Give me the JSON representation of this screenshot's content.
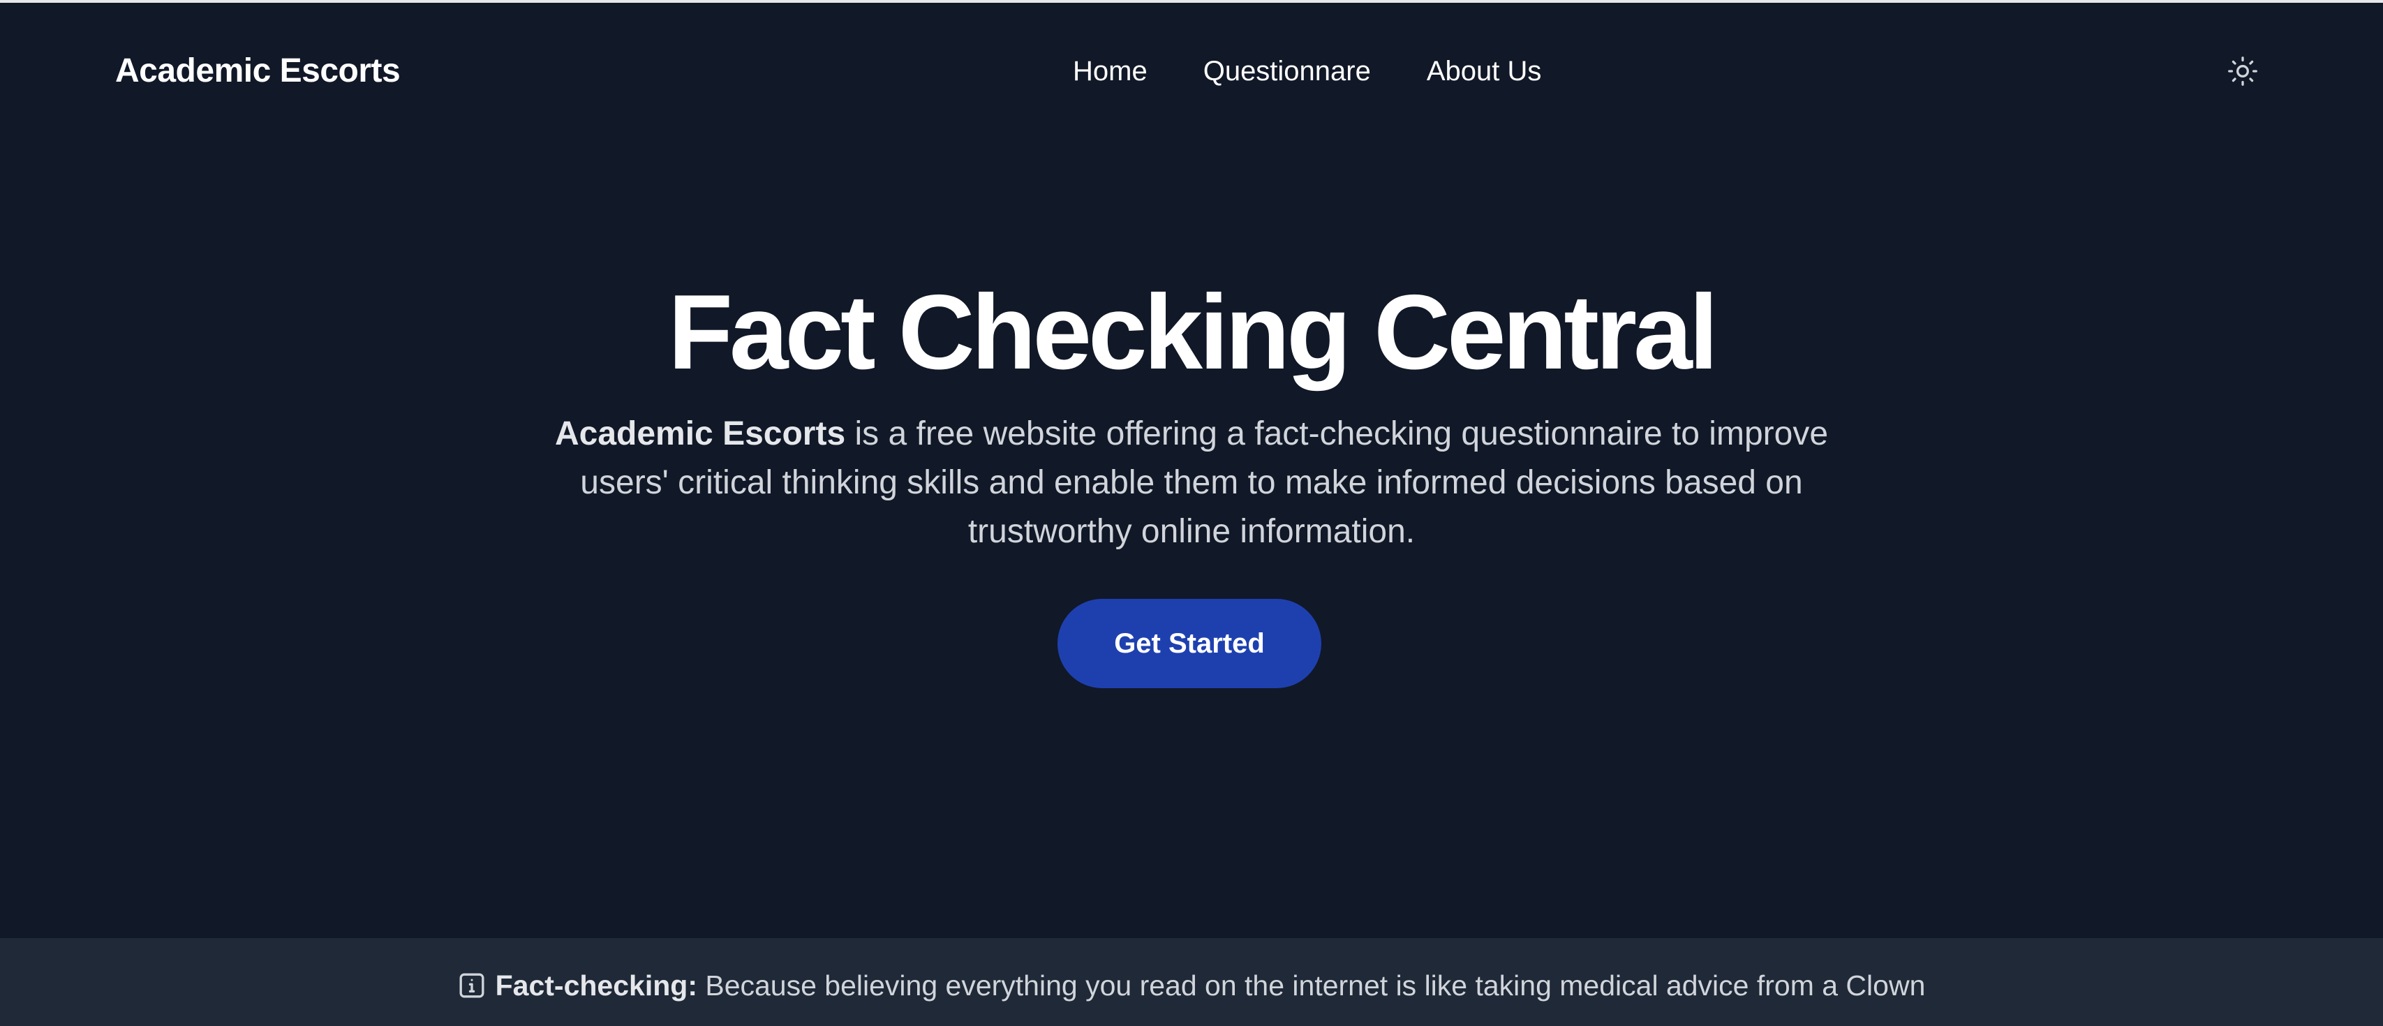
{
  "header": {
    "brand": "Academic Escorts",
    "nav": [
      {
        "label": "Home"
      },
      {
        "label": "Questionnare"
      },
      {
        "label": "About Us"
      }
    ],
    "theme_toggle_icon": "sun-icon"
  },
  "hero": {
    "title": "Fact Checking Central",
    "description_bold": "Academic Escorts",
    "description_rest": " is a free website offering a fact-checking questionnaire to improve users' critical thinking skills and enable them to make informed decisions based on trustworthy online information.",
    "cta_label": "Get Started"
  },
  "banner": {
    "icon": "info-icon",
    "bold": "Fact-checking:",
    "text": " Because believing everything you read on the internet is like taking medical advice from a Clown"
  },
  "colors": {
    "background": "#111827",
    "banner_background": "#1f2937",
    "accent": "#1e40af",
    "text_primary": "#ffffff",
    "text_secondary": "#d1d5db"
  }
}
